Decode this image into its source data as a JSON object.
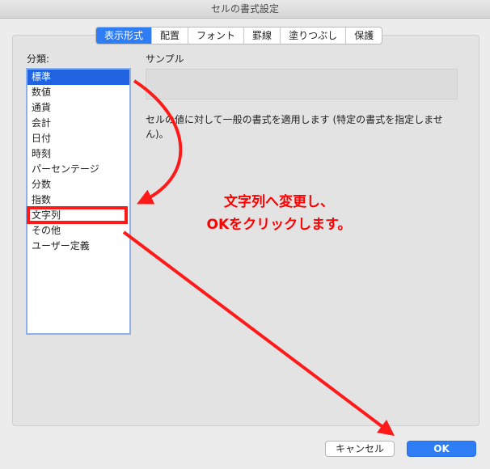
{
  "window": {
    "title": "セルの書式設定"
  },
  "tabs": [
    {
      "label": "表示形式",
      "active": true
    },
    {
      "label": "配置",
      "active": false
    },
    {
      "label": "フォント",
      "active": false
    },
    {
      "label": "罫線",
      "active": false
    },
    {
      "label": "塗りつぶし",
      "active": false
    },
    {
      "label": "保護",
      "active": false
    }
  ],
  "category": {
    "label": "分類:",
    "items": [
      "標準",
      "数値",
      "通貨",
      "会計",
      "日付",
      "時刻",
      "パーセンテージ",
      "分数",
      "指数",
      "文字列",
      "その他",
      "ユーザー定義"
    ],
    "selected_index": 0
  },
  "sample": {
    "label": "サンプル",
    "value": ""
  },
  "description": "セルの値に対して一般の書式を適用します (特定の書式を指定しません)。",
  "annotation": {
    "line1": "文字列へ変更し、",
    "line2": "OKをクリックします。",
    "color": "#ff0000"
  },
  "buttons": {
    "cancel_label": "キャンセル",
    "ok_label": "OK"
  },
  "colors": {
    "accent": "#2f7df5",
    "selection": "#1f63e0",
    "annotation": "#ff1a1a"
  }
}
